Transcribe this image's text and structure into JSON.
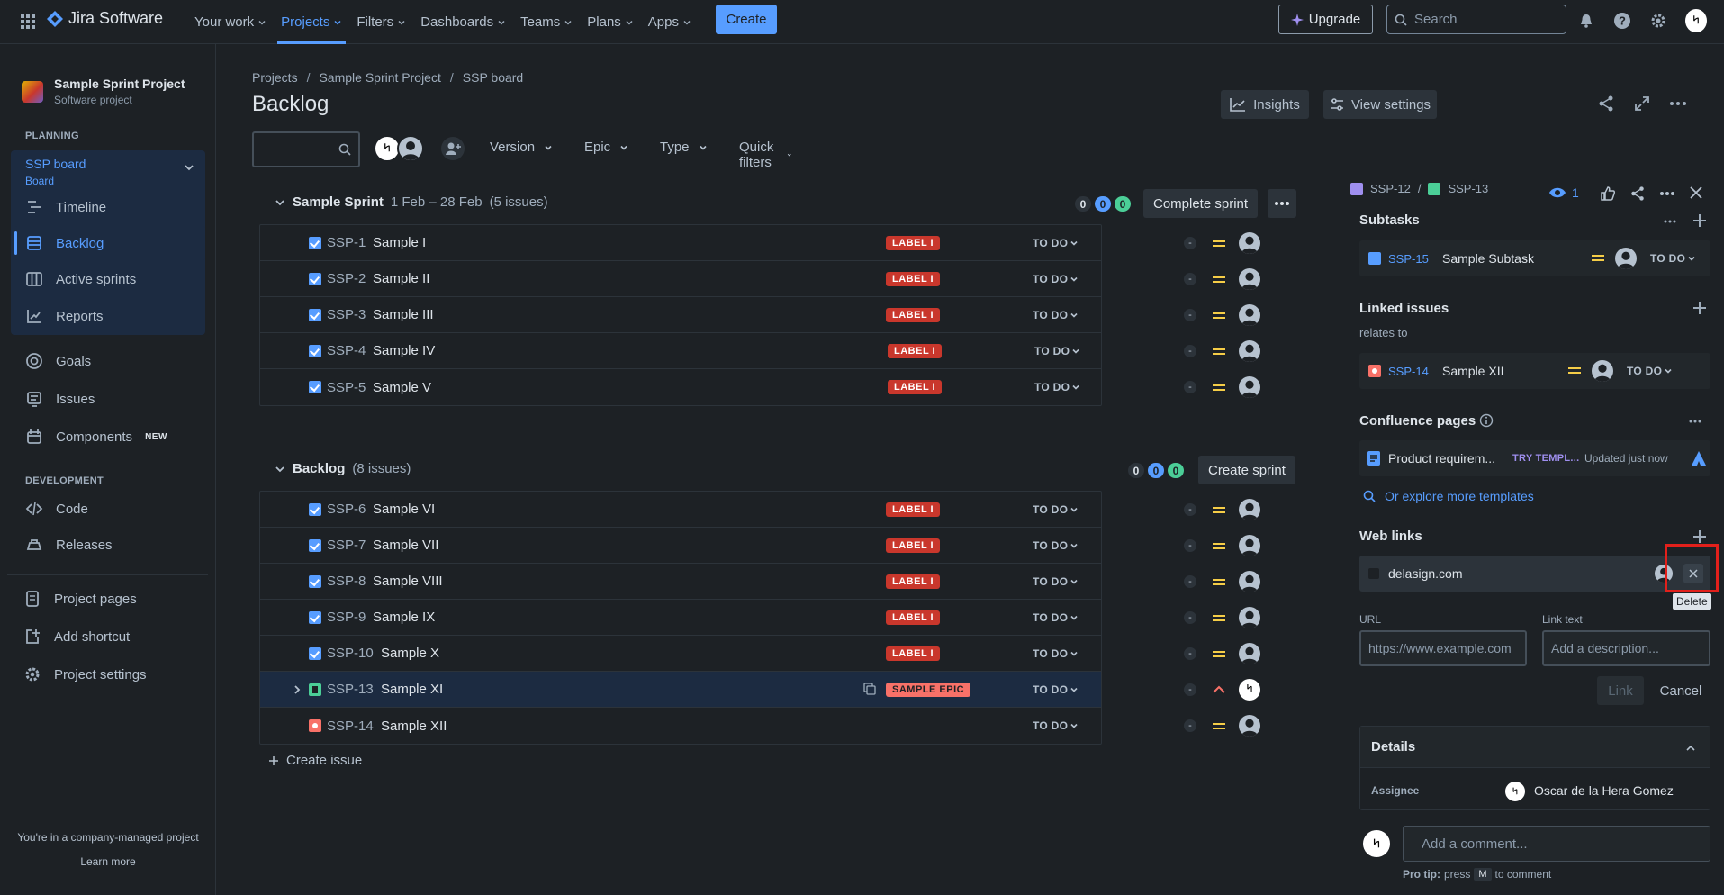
{
  "topnav": {
    "product": "Jira Software",
    "items": [
      {
        "label": "Your work",
        "active": false
      },
      {
        "label": "Projects",
        "active": true
      },
      {
        "label": "Filters",
        "active": false
      },
      {
        "label": "Dashboards",
        "active": false
      },
      {
        "label": "Teams",
        "active": false
      },
      {
        "label": "Plans",
        "active": false
      },
      {
        "label": "Apps",
        "active": false
      }
    ],
    "create": "Create",
    "upgrade": "Upgrade",
    "search_placeholder": "Search",
    "user_initials": "৸"
  },
  "sidebar": {
    "project_name": "Sample Sprint Project",
    "project_type": "Software project",
    "planning_header": "PLANNING",
    "board_title": "SSP board",
    "board_sub": "Board",
    "planning_items": [
      {
        "label": "Timeline",
        "icon": "timeline-icon"
      },
      {
        "label": "Backlog",
        "icon": "backlog-icon",
        "selected": true
      },
      {
        "label": "Active sprints",
        "icon": "board-columns-icon"
      },
      {
        "label": "Reports",
        "icon": "reports-chart-icon"
      }
    ],
    "other_items": [
      {
        "label": "Goals",
        "icon": "goal-icon"
      },
      {
        "label": "Issues",
        "icon": "issues-icon"
      },
      {
        "label": "Components",
        "icon": "components-icon",
        "badge": "NEW"
      }
    ],
    "development_header": "DEVELOPMENT",
    "dev_items": [
      {
        "label": "Code",
        "icon": "code-icon"
      },
      {
        "label": "Releases",
        "icon": "releases-icon"
      }
    ],
    "bottom_items": [
      {
        "label": "Project pages",
        "icon": "pages-icon"
      },
      {
        "label": "Add shortcut",
        "icon": "add-shortcut-icon"
      },
      {
        "label": "Project settings",
        "icon": "gear-icon"
      }
    ],
    "footer_text": "You're in a company-managed project",
    "learn_more": "Learn more"
  },
  "main": {
    "breadcrumb": [
      "Projects",
      "Sample Sprint Project",
      "SSP board"
    ],
    "title": "Backlog",
    "filters": [
      "Version",
      "Epic",
      "Type",
      "Quick filters"
    ],
    "insights": "Insights",
    "view_settings": "View settings"
  },
  "sprint": {
    "name": "Sample Sprint",
    "dates": "1 Feb – 28 Feb",
    "count": "(5 issues)",
    "counts": [
      "0",
      "0",
      "0"
    ],
    "button": "Complete sprint",
    "issues": [
      {
        "key": "SSP-1",
        "summary": "Sample I",
        "label": "LABEL I",
        "status": "TO DO",
        "est": "-"
      },
      {
        "key": "SSP-2",
        "summary": "Sample II",
        "label": "LABEL I",
        "status": "TO DO",
        "est": "-"
      },
      {
        "key": "SSP-3",
        "summary": "Sample III",
        "label": "LABEL I",
        "status": "TO DO",
        "est": "-"
      },
      {
        "key": "SSP-4",
        "summary": "Sample IV",
        "label": "LABEL I",
        "status": "TO DO",
        "est": "-"
      },
      {
        "key": "SSP-5",
        "summary": "Sample V",
        "label": "LABEL I",
        "status": "TO DO",
        "est": "-"
      }
    ]
  },
  "backlog": {
    "name": "Backlog",
    "count": "(8 issues)",
    "counts": [
      "0",
      "0",
      "0"
    ],
    "button": "Create sprint",
    "issues": [
      {
        "key": "SSP-6",
        "summary": "Sample VI",
        "label": "LABEL I",
        "status": "TO DO",
        "est": "-"
      },
      {
        "key": "SSP-7",
        "summary": "Sample VII",
        "label": "LABEL I",
        "status": "TO DO",
        "est": "-"
      },
      {
        "key": "SSP-8",
        "summary": "Sample VIII",
        "label": "LABEL I",
        "status": "TO DO",
        "est": "-"
      },
      {
        "key": "SSP-9",
        "summary": "Sample IX",
        "label": "LABEL I",
        "status": "TO DO",
        "est": "-"
      },
      {
        "key": "SSP-10",
        "summary": "Sample X",
        "label": "LABEL I",
        "status": "TO DO",
        "est": "-"
      },
      {
        "key": "SSP-13",
        "summary": "Sample XI",
        "label": "SAMPLE EPIC",
        "status": "TO DO",
        "est": "-"
      },
      {
        "key": "SSP-14",
        "summary": "Sample XII",
        "label": "",
        "status": "TO DO",
        "est": "-"
      }
    ],
    "create_issue": "Create issue"
  },
  "panel": {
    "crumb_parent": "SSP-12",
    "crumb_sep": "/",
    "crumb_current": "SSP-13",
    "watchers": "1",
    "subtasks_title": "Subtasks",
    "subtask": {
      "key": "SSP-15",
      "summary": "Sample Subtask",
      "status": "TO DO"
    },
    "linked_title": "Linked issues",
    "relates_to": "relates to",
    "linked": {
      "key": "SSP-14",
      "summary": "Sample XII",
      "status": "TO DO"
    },
    "confluence_title": "Confluence pages",
    "confluence_page": "Product requirem...",
    "try_template": "TRY TEMPL...",
    "updated": "Updated just now",
    "explore": "Or explore more templates",
    "weblinks_title": "Web links",
    "weblink": "delasign.com",
    "delete_tooltip": "Delete",
    "url_label": "URL",
    "url_placeholder": "https://www.example.com",
    "linktext_label": "Link text",
    "linktext_placeholder": "Add a description...",
    "link_btn": "Link",
    "cancel_btn": "Cancel",
    "details_title": "Details",
    "assignee_label": "Assignee",
    "assignee_name": "Oscar de la Hera Gomez",
    "comment_placeholder": "Add a comment...",
    "tip_bold": "Pro tip:",
    "tip_press": "press",
    "tip_key": "M",
    "tip_rest": "to comment"
  },
  "colors": {
    "accent": "#579dff",
    "label_red": "#c9372c",
    "highlight": "#e2201b"
  }
}
